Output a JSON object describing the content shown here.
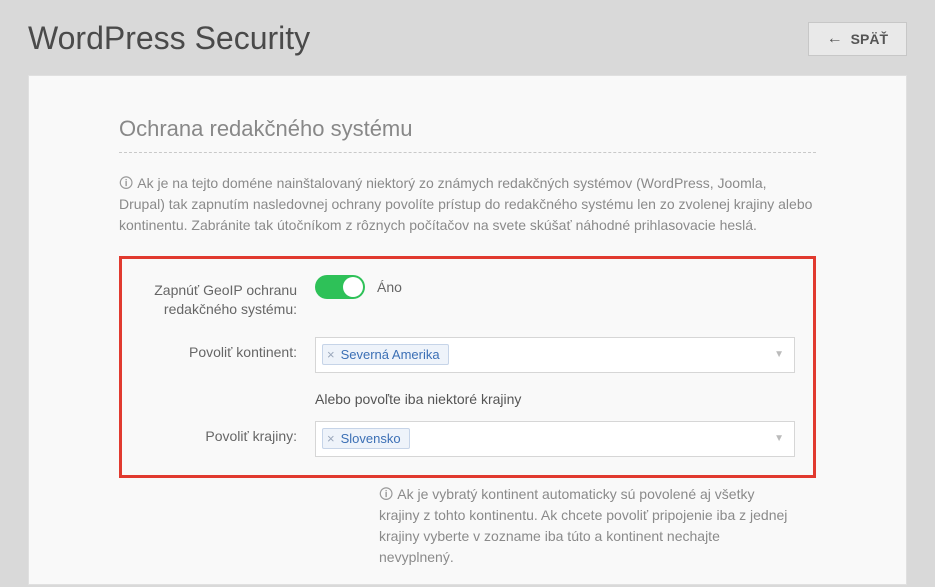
{
  "header": {
    "title": "WordPress Security",
    "back_label": "SPÄŤ"
  },
  "section": {
    "title": "Ochrana redakčného systému",
    "description": "Ak je na tejto doméne nainštalovaný niektorý zo známych redakčných systémov (WordPress, Joomla, Drupal) tak zapnutím nasledovnej ochrany povolíte prístup do redakčného systému len zo zvolenej krajiny alebo kontinentu. Zabránite tak útočníkom z rôznych počítačov na svete skúšať náhodné prihlasovacie heslá."
  },
  "form": {
    "enable_label": "Zapnúť GeoIP ochranu redakčného systému:",
    "enable_value": "Áno",
    "continent_label": "Povoliť kontinent:",
    "continent_value": "Severná Amerika",
    "or_hint": "Alebo povoľte iba niektoré krajiny",
    "country_label": "Povoliť krajiny:",
    "country_value": "Slovensko",
    "footer_desc": "Ak je vybratý kontinent automaticky sú povolené aj všetky krajiny z tohto kontinentu. Ak chcete povoliť pripojenie iba z jednej krajiny vyberte v zozname iba túto a kontinent nechajte nevyplnený."
  }
}
